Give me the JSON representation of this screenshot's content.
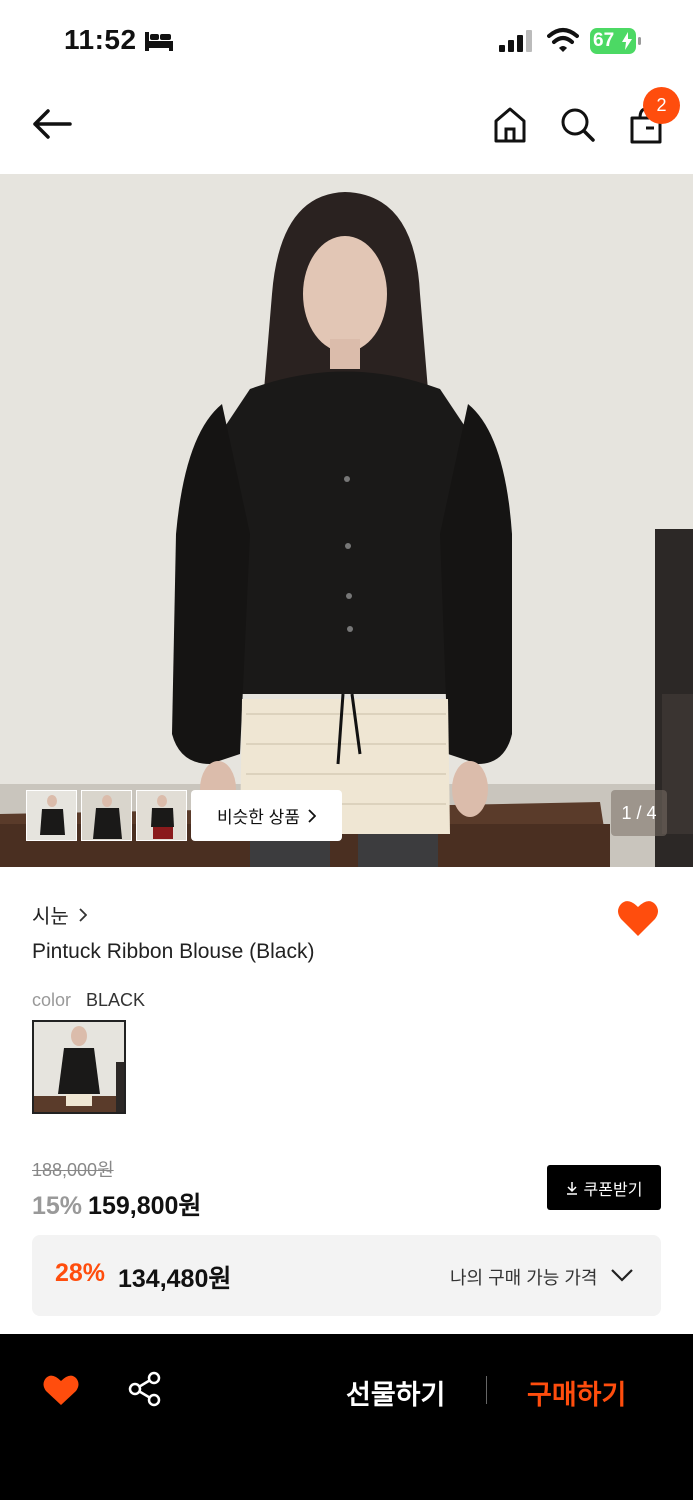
{
  "status_bar": {
    "time": "11:52",
    "battery": "67"
  },
  "nav": {
    "cart_count": "2"
  },
  "gallery": {
    "similar_label": "비슷한 상품",
    "counter": "1 / 4"
  },
  "product": {
    "brand": "시눈",
    "name": "Pintuck Ribbon Blouse (Black)",
    "color_label": "color",
    "color_value": "BLACK"
  },
  "price": {
    "original": "188,000원",
    "discount": "15%",
    "sale": "159,800원",
    "coupon_label": "쿠폰받기",
    "my_discount": "28%",
    "my_price": "134,480원",
    "my_price_label": "나의 구매 가능 가격"
  },
  "bottom_bar": {
    "gift_label": "선물하기",
    "buy_label": "구매하기"
  },
  "colors": {
    "accent": "#ff4d0d",
    "bar": "#000000"
  }
}
